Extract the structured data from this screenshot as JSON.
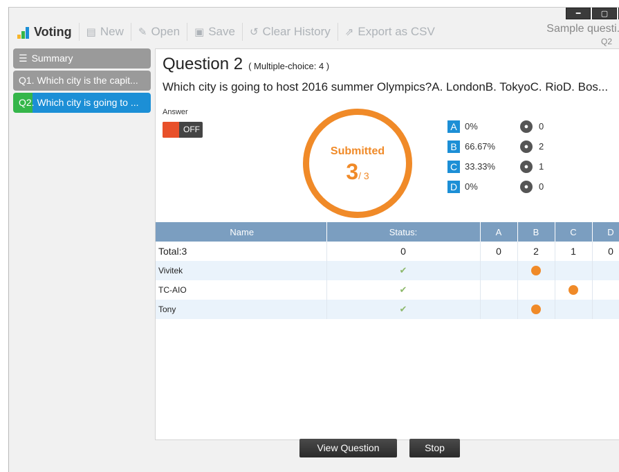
{
  "window": {
    "minimize": "━",
    "maximize": "▢",
    "close": "✕"
  },
  "toolbar": {
    "voting": "Voting",
    "new": "New",
    "open": "Open",
    "save": "Save",
    "clear_history": "Clear History",
    "export": "Export as CSV"
  },
  "session": {
    "title": "Sample questi...",
    "current": "Q2"
  },
  "sidebar": {
    "items": [
      {
        "label": "Summary"
      },
      {
        "label": "Q1. Which city is the capit..."
      },
      {
        "label": "Q2. Which city is going to ..."
      }
    ],
    "selected": "Q2"
  },
  "question": {
    "title": "Question 2",
    "type": "( Multiple-choice: 4 )",
    "text": "Which city is going to host 2016 summer Olympics?A. LondonB. TokyoC. RioD. Bos..."
  },
  "answer": {
    "label": "Answer",
    "toggle": "OFF"
  },
  "submitted": {
    "label": "Submitted",
    "count": "3",
    "total": "/ 3"
  },
  "stats": [
    {
      "option": "A",
      "percent": "0%",
      "count": "0"
    },
    {
      "option": "B",
      "percent": "66.67%",
      "count": "2"
    },
    {
      "option": "C",
      "percent": "33.33%",
      "count": "1"
    },
    {
      "option": "D",
      "percent": "0%",
      "count": "0"
    }
  ],
  "table": {
    "headers": [
      "Name",
      "Status:",
      "A",
      "B",
      "C",
      "D"
    ],
    "total": {
      "name": "Total:3",
      "status": "0",
      "a": "0",
      "b": "2",
      "c": "1",
      "d": "0"
    },
    "rows": [
      {
        "name": "Vivitek",
        "answer": "B"
      },
      {
        "name": "TC-AIO",
        "answer": "C"
      },
      {
        "name": "Tony",
        "answer": "B"
      }
    ]
  },
  "buttons": {
    "view_question": "View Question",
    "stop": "Stop"
  },
  "colors": {
    "accent_orange": "#f08a28",
    "option_blue": "#1c8fd6",
    "header_blue": "#7b9ec0",
    "selected_green": "#35b64a"
  }
}
